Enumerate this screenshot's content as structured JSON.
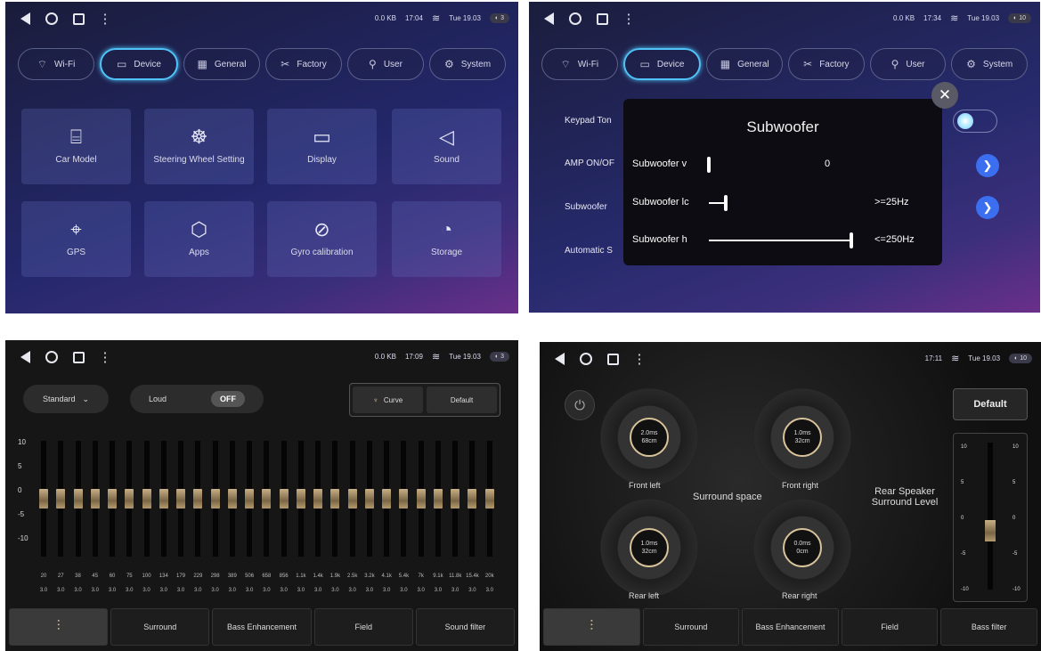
{
  "s1": {
    "status": {
      "kb": "0.0 KB",
      "time": "17:04",
      "date": "Tue 19.03",
      "pill": "◐ 3"
    },
    "tabs": [
      {
        "label": "Wi-Fi",
        "icon": "⌔"
      },
      {
        "label": "Device",
        "icon": "▭"
      },
      {
        "label": "General",
        "icon": "▦"
      },
      {
        "label": "Factory",
        "icon": "✂"
      },
      {
        "label": "User",
        "icon": "⚲"
      },
      {
        "label": "System",
        "icon": "⚙"
      }
    ],
    "tiles": [
      {
        "label": "Car Model",
        "icon": "⌸"
      },
      {
        "label": "Steering Wheel Setting",
        "icon": "☸"
      },
      {
        "label": "Display",
        "icon": "▭"
      },
      {
        "label": "Sound",
        "icon": "◁"
      },
      {
        "label": "GPS",
        "icon": "⌖"
      },
      {
        "label": "Apps",
        "icon": "⬡"
      },
      {
        "label": "Gyro calibration",
        "icon": "⊘"
      },
      {
        "label": "Storage",
        "icon": "◔"
      }
    ]
  },
  "s2": {
    "status": {
      "kb": "0.0 KB",
      "time": "17:34",
      "date": "Tue 19.03",
      "pill": "◐ 10"
    },
    "tabs": [
      {
        "label": "Wi-Fi",
        "icon": "⌔"
      },
      {
        "label": "Device",
        "icon": "▭"
      },
      {
        "label": "General",
        "icon": "▦"
      },
      {
        "label": "Factory",
        "icon": "✂"
      },
      {
        "label": "User",
        "icon": "⚲"
      },
      {
        "label": "System",
        "icon": "⚙"
      }
    ],
    "rows": [
      "Keypad Ton",
      "AMP ON/OF",
      "Subwoofer",
      "Automatic S"
    ],
    "popup": {
      "title": "Subwoofer",
      "rows": [
        {
          "label": "Subwoofer v",
          "value": "0"
        },
        {
          "label": "Subwoofer lc",
          "value": ">=25Hz"
        },
        {
          "label": "Subwoofer h",
          "value": "<=250Hz"
        }
      ],
      "levels": [
        0,
        0.12,
        1
      ]
    }
  },
  "s3": {
    "status": {
      "kb": "0.0 KB",
      "time": "17:09",
      "date": "Tue 19.03",
      "pill": "◐ 3"
    },
    "preset": "Standard",
    "loud": "Loud",
    "loud_state": "OFF",
    "curve": "Curve",
    "default": "Default",
    "yticks": [
      "10",
      "5",
      "0",
      "-5",
      "-10"
    ],
    "freqs": [
      "20",
      "27",
      "38",
      "45",
      "60",
      "75",
      "100",
      "134",
      "179",
      "229",
      "298",
      "389",
      "506",
      "658",
      "856",
      "1.1k",
      "1.4k",
      "1.9k",
      "2.5k",
      "3.2k",
      "4.1k",
      "5.4k",
      "7k",
      "9.1k",
      "11.8k",
      "15.4k",
      "20k"
    ],
    "gains": [
      "3.0",
      "3.0",
      "3.0",
      "3.0",
      "3.0",
      "3.0",
      "3.0",
      "3.0",
      "3.0",
      "3.0",
      "3.0",
      "3.0",
      "3.0",
      "3.0",
      "3.0",
      "3.0",
      "3.0",
      "3.0",
      "3.0",
      "3.0",
      "3.0",
      "3.0",
      "3.0",
      "3.0",
      "3.0",
      "3.0",
      "3.0"
    ],
    "tabs": [
      "",
      "Surround",
      "Bass Enhancement",
      "Field",
      "Sound filter"
    ]
  },
  "s4": {
    "status": {
      "time": "17:11",
      "date": "Tue 19.03",
      "pill": "◐ 10"
    },
    "default": "Default",
    "dials": [
      {
        "l1": "2.0ms",
        "l2": "68cm",
        "label": "Front left"
      },
      {
        "l1": "1.0ms",
        "l2": "32cm",
        "label": "Front right"
      },
      {
        "l1": "1.0ms",
        "l2": "32cm",
        "label": "Rear left"
      },
      {
        "l1": "0.0ms",
        "l2": "0cm",
        "label": "Rear right"
      }
    ],
    "surround_space": "Surround space",
    "rear_level": "Rear Speaker Surround Level",
    "vticks": [
      "10",
      "5",
      "0",
      "-5",
      "-10"
    ],
    "tabs": [
      "",
      "Surround",
      "Bass Enhancement",
      "Field",
      "Bass filter"
    ]
  }
}
